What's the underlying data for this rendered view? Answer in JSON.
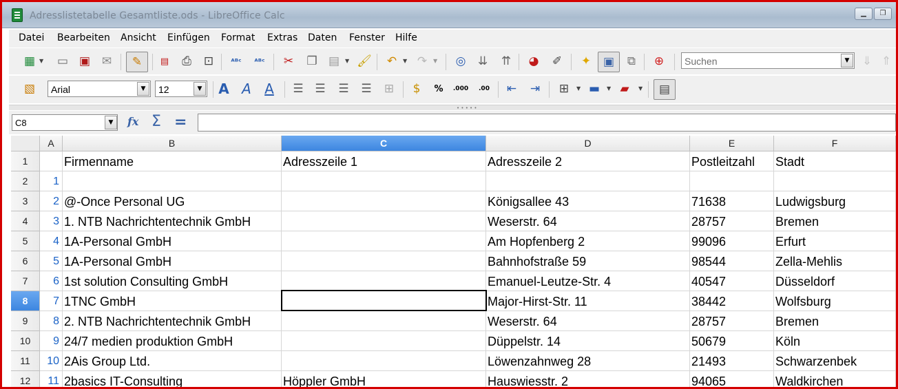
{
  "window": {
    "title": "Adresslistetabelle Gesamtliste.ods - LibreOffice Calc",
    "minimize_glyph": "▭",
    "restore_glyph": "⧉"
  },
  "menu": [
    {
      "label": "Datei"
    },
    {
      "label": "Bearbeiten"
    },
    {
      "label": "Ansicht"
    },
    {
      "label": "Einfügen"
    },
    {
      "label": "Format"
    },
    {
      "label": "Extras"
    },
    {
      "label": "Daten"
    },
    {
      "label": "Fenster"
    },
    {
      "label": "Hilfe"
    }
  ],
  "toolbar": {
    "search_placeholder": "Suchen",
    "font_name": "Arial",
    "font_size": "12",
    "percent_label": "%",
    "decimal_add_label": ".000",
    "decimal_remove_label": ".00"
  },
  "formula_bar": {
    "cell_reference": "C8",
    "content": ""
  },
  "sheet": {
    "columns": [
      "A",
      "B",
      "C",
      "D",
      "E",
      "F"
    ],
    "active_column": "C",
    "active_row": "8",
    "rows": [
      {
        "row": "1",
        "a": "",
        "b": "Firmenname",
        "c": "Adresszeile 1",
        "d": "Adresszeile 2",
        "e": "Postleitzahl",
        "f": "Stadt"
      },
      {
        "row": "2",
        "a": "1",
        "b": "",
        "c": "",
        "d": "",
        "e": "",
        "f": ""
      },
      {
        "row": "3",
        "a": "2",
        "b": "@-Once Personal UG",
        "c": "",
        "d": "Königsallee 43",
        "e": "71638",
        "f": "Ludwigsburg"
      },
      {
        "row": "4",
        "a": "3",
        "b": "1. NTB Nachrichtentechnik GmbH",
        "c": "",
        "d": "Weserstr. 64",
        "e": "28757",
        "f": "Bremen"
      },
      {
        "row": "5",
        "a": "4",
        "b": "1A-Personal GmbH",
        "c": "",
        "d": "Am Hopfenberg 2",
        "e": "99096",
        "f": "Erfurt"
      },
      {
        "row": "6",
        "a": "5",
        "b": "1A-Personal GmbH",
        "c": "",
        "d": "Bahnhofstraße 59",
        "e": "98544",
        "f": "Zella-Mehlis"
      },
      {
        "row": "7",
        "a": "6",
        "b": "1st solution Consulting GmbH",
        "c": "",
        "d": "Emanuel-Leutze-Str. 4",
        "e": "40547",
        "f": "Düsseldorf"
      },
      {
        "row": "8",
        "a": "7",
        "b": "1TNC GmbH",
        "c": "",
        "d": "Major-Hirst-Str. 11",
        "e": "38442",
        "f": "Wolfsburg"
      },
      {
        "row": "9",
        "a": "8",
        "b": "2. NTB Nachrichtentechnik GmbH",
        "c": "",
        "d": "Weserstr. 64",
        "e": "28757",
        "f": "Bremen"
      },
      {
        "row": "10",
        "a": "9",
        "b": "24/7 medien produktion GmbH",
        "c": "",
        "d": "Düppelstr. 14",
        "e": "50679",
        "f": "Köln"
      },
      {
        "row": "11",
        "a": "10",
        "b": "2Ais Group Ltd.",
        "c": "",
        "d": "Löwenzahnweg 28",
        "e": "21493",
        "f": "Schwarzenbek"
      },
      {
        "row": "12",
        "a": "11",
        "b": "2basics IT-Consulting",
        "c": "Höppler GmbH",
        "d": "Hauswiesstr. 2",
        "e": "94065",
        "f": "Waldkirchen"
      }
    ]
  }
}
